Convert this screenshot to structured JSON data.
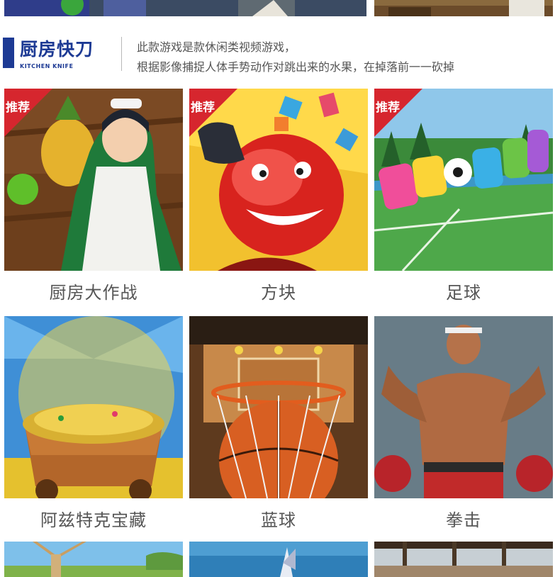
{
  "section": {
    "title": "厨房快刀",
    "subtitle": "KITCHEN KNIFE",
    "description_line1": "此款游戏是款休闲类视频游戏，",
    "description_line2": "根据影像捕捉人体手势动作对跳出来的水果，在掉落前一一砍掉"
  },
  "games": [
    {
      "title": "厨房大作战",
      "badge": "推荐",
      "icon": "maid-fruit-game-thumbnail"
    },
    {
      "title": "方块",
      "badge": "推荐",
      "icon": "red-ball-blocks-thumbnail"
    },
    {
      "title": "足球",
      "badge": "推荐",
      "icon": "cooball-soccer-thumbnail"
    },
    {
      "title": "阿兹特克宝藏",
      "icon": "treasure-cart-thumbnail"
    },
    {
      "title": "蓝球",
      "icon": "basketball-hoop-thumbnail"
    },
    {
      "title": "拳击",
      "icon": "boxer-thumbnail"
    }
  ],
  "colors": {
    "accent": "#1d3a94",
    "badge": "#d6262e",
    "caption_text": "#555555"
  }
}
